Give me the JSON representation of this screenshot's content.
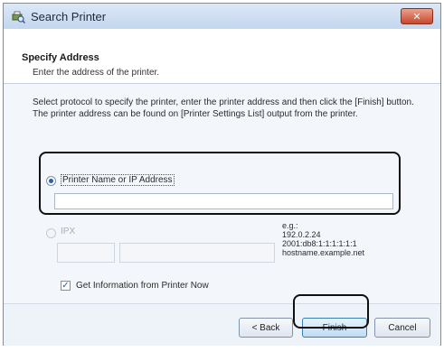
{
  "window": {
    "title": "Search Printer",
    "close_label": "✕"
  },
  "header": {
    "title": "Specify Address",
    "subtitle": "Enter the address of the printer."
  },
  "description": {
    "line1": "Select protocol to specify the printer, enter the printer address and then click the [Finish] button.",
    "line2": "The printer address can be found on [Printer Settings List] output from the printer."
  },
  "options": {
    "printer_name_label": "Printer Name or IP Address",
    "printer_name_value": "",
    "ipx_label": "IPX",
    "ipx_network_value": "",
    "ipx_node_value": ""
  },
  "example": {
    "heading": "e.g.:",
    "lines": [
      "192.0.2.24",
      "2001:db8:1:1:1:1:1:1",
      "hostname.example.net"
    ]
  },
  "checkbox": {
    "label": "Get Information from Printer Now",
    "checked": true,
    "mark": "✓"
  },
  "buttons": {
    "back": "< Back",
    "finish": "Finish",
    "cancel": "Cancel"
  }
}
